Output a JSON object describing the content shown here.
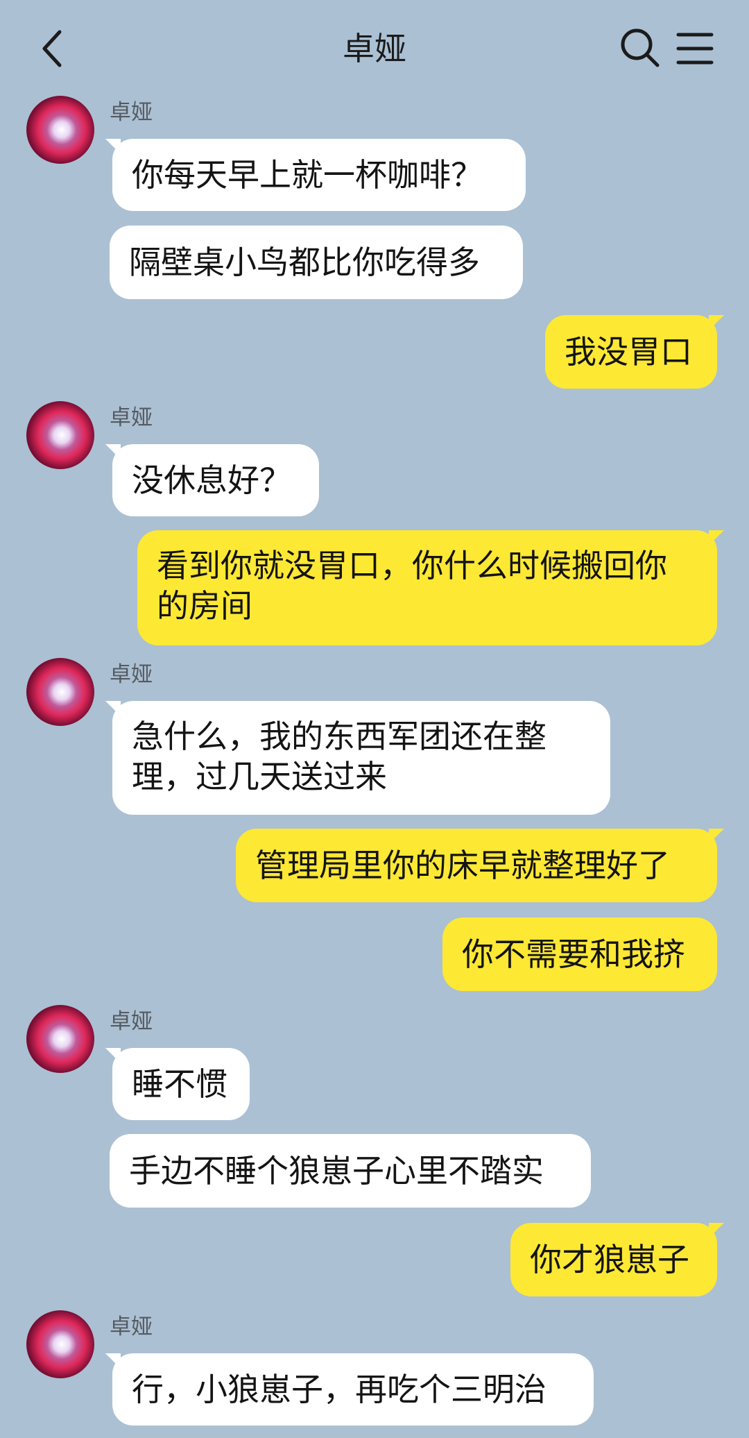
{
  "header": {
    "title": "卓娅",
    "back_icon": "chevron-left-icon",
    "search_icon": "search-icon",
    "menu_icon": "hamburger-menu-icon"
  },
  "contact": {
    "name": "卓娅"
  },
  "colors": {
    "background": "#abc0d3",
    "incoming_bubble": "#ffffff",
    "outgoing_bubble": "#fde834"
  },
  "messages": [
    {
      "sender": "卓娅",
      "direction": "incoming",
      "text": "你每天早上就一杯咖啡？"
    },
    {
      "sender": "卓娅",
      "direction": "incoming",
      "text": "隔壁桌小鸟都比你吃得多"
    },
    {
      "sender": "me",
      "direction": "outgoing",
      "text": "我没胃口"
    },
    {
      "sender": "卓娅",
      "direction": "incoming",
      "text": "没休息好？"
    },
    {
      "sender": "me",
      "direction": "outgoing",
      "text": "看到你就没胃口，你什么时候搬回你的房间"
    },
    {
      "sender": "卓娅",
      "direction": "incoming",
      "text": "急什么，我的东西军团还在整理，过几天送过来"
    },
    {
      "sender": "me",
      "direction": "outgoing",
      "text": "管理局里你的床早就整理好了"
    },
    {
      "sender": "me",
      "direction": "outgoing",
      "text": "你不需要和我挤"
    },
    {
      "sender": "卓娅",
      "direction": "incoming",
      "text": "睡不惯"
    },
    {
      "sender": "卓娅",
      "direction": "incoming",
      "text": "手边不睡个狼崽子心里不踏实"
    },
    {
      "sender": "me",
      "direction": "outgoing",
      "text": "你才狼崽子"
    },
    {
      "sender": "卓娅",
      "direction": "incoming",
      "text": "行，小狼崽子，再吃个三明治"
    }
  ]
}
